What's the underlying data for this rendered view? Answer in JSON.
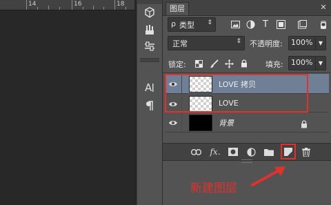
{
  "ruler": {
    "ticks": [
      "14",
      "16",
      "18"
    ]
  },
  "layers_panel": {
    "tab_label": "图层",
    "filter": {
      "icon_glyph": "ρ",
      "value": "类型"
    },
    "blend_mode": "正常",
    "opacity_label": "不透明度:",
    "opacity_value": "100%",
    "lock_label": "锁定:",
    "fill_label": "填充:",
    "fill_value": "100%",
    "layers": [
      {
        "name": "LOVE 拷贝",
        "selected": true,
        "thumb": "transparent",
        "locked": false
      },
      {
        "name": "LOVE",
        "selected": false,
        "thumb": "transparent",
        "locked": false
      },
      {
        "name": "背景",
        "selected": false,
        "thumb": "black",
        "locked": true
      }
    ]
  },
  "annotation": {
    "text": "新建图层",
    "color": "#e0322d"
  },
  "colors": {
    "panel_bg": "#535353",
    "selected_layer": "#6f7f96",
    "highlight_red": "#e0322d"
  }
}
